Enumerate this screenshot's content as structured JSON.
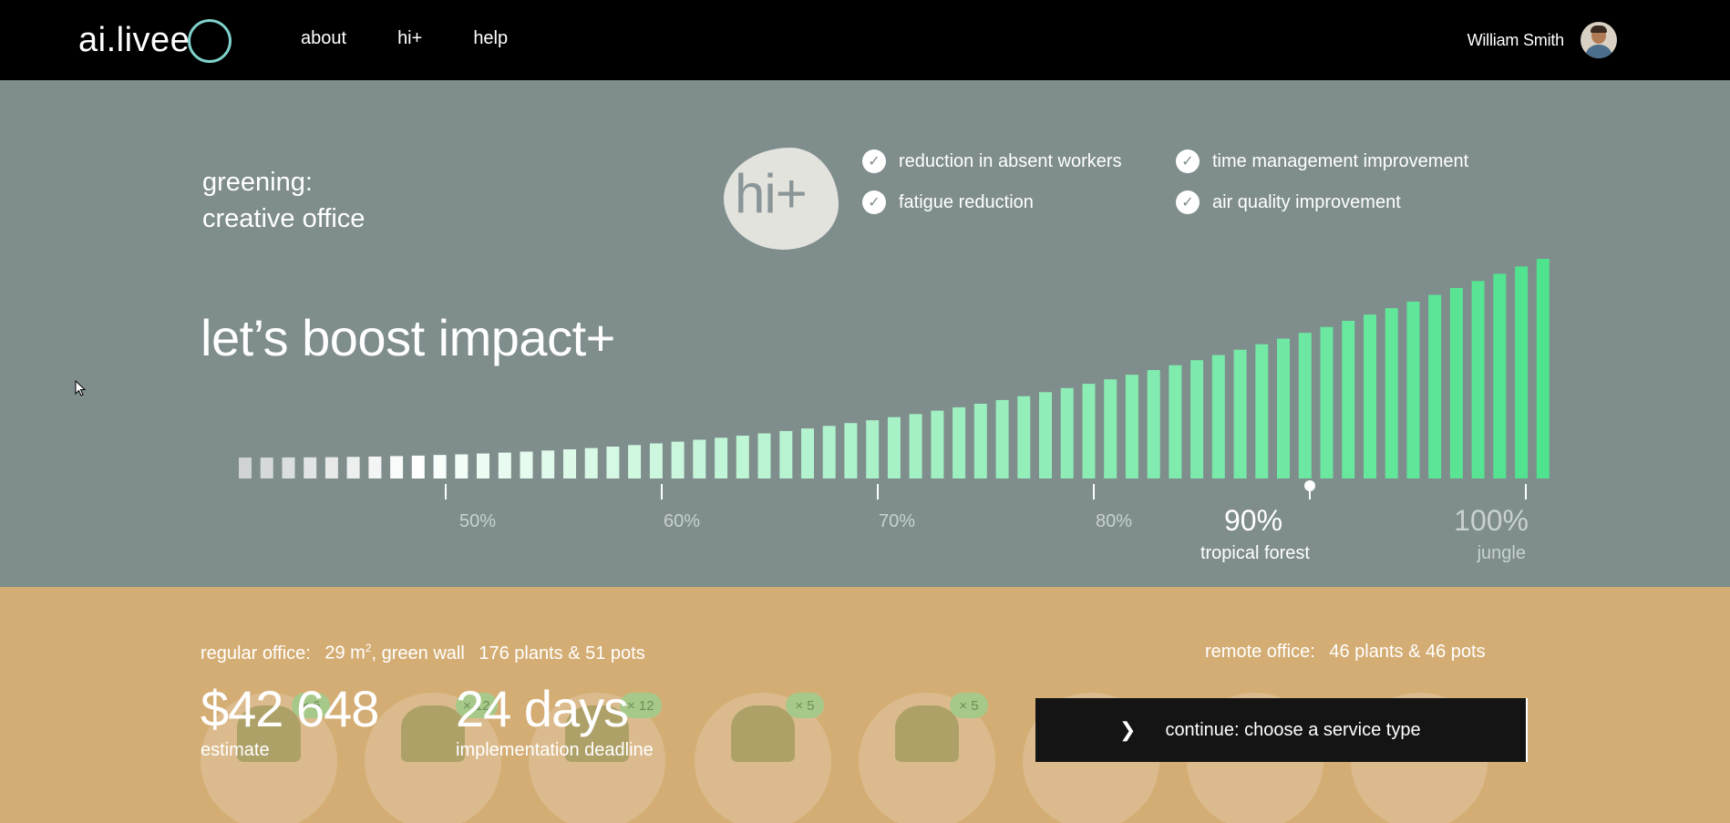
{
  "header": {
    "logo_text": "ai.livee",
    "nav": [
      {
        "label": "about"
      },
      {
        "label": "hi+"
      },
      {
        "label": "help"
      }
    ],
    "user_name": "William Smith"
  },
  "impact": {
    "project_line1": "greening:",
    "project_line2": "creative office",
    "badge": "hi+",
    "benefits": [
      "reduction in absent workers",
      "time management improvement",
      "fatigue reduction",
      "air quality improvement"
    ],
    "headline": "let’s boost impact+",
    "scale": {
      "ticks": [
        "50%",
        "60%",
        "70%",
        "80%",
        "90%",
        "100%"
      ],
      "selected_value": 90,
      "selected_label": "90%",
      "selected_name": "tropical forest",
      "max_name": "jungle",
      "colors": {
        "low": "#cfd3d3",
        "mid": "#ffffff",
        "high": "#4fe38e"
      }
    }
  },
  "summary": {
    "regular_office": {
      "prefix": "regular office:",
      "area": "29 m",
      "area_sup": "2",
      "area_suffix": ", green wall",
      "plants": "176 plants & 51 pots"
    },
    "remote_office": {
      "prefix": "remote office:",
      "plants": "46 plants & 46 pots"
    },
    "plant_quantities": [
      "× 6",
      "× 12",
      "× 12",
      "× 5",
      "× 5",
      "",
      "",
      "",
      ""
    ],
    "estimate_value": "$42 648",
    "estimate_label": "estimate",
    "deadline_value": "24 days",
    "deadline_label": "implementation deadline",
    "cta_label": "continue: choose a service type"
  }
}
